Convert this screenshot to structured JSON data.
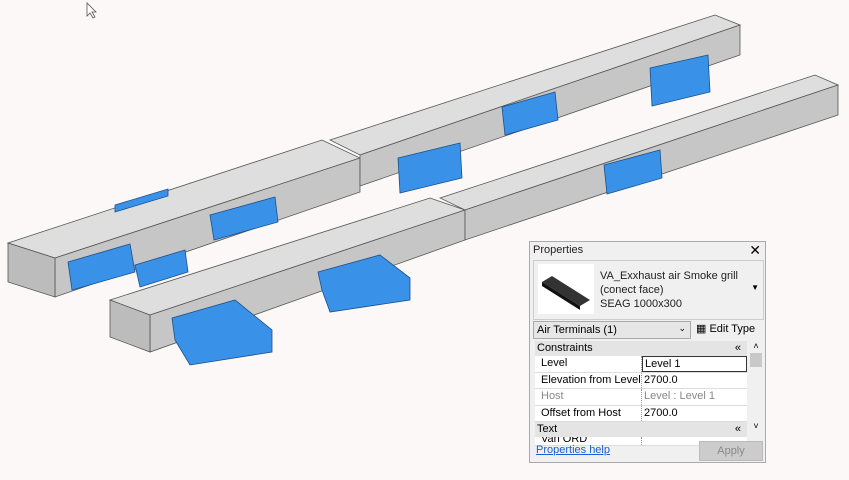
{
  "properties": {
    "title": "Properties",
    "type_name_line1": "VA_Exxhaust air Smoke grill",
    "type_name_line2": "(conect face)",
    "type_name_line3": "SEAG 1000x300",
    "selector": "Air Terminals (1)",
    "edit_type": "Edit Type",
    "categories": [
      {
        "name": "Constraints",
        "rows": [
          {
            "label": "Level",
            "value": "Level 1"
          },
          {
            "label": "Elevation from Level",
            "value": "2700.0"
          },
          {
            "label": "Host",
            "value": "Level : Level 1",
            "disabled": true
          },
          {
            "label": "Offset from Host",
            "value": "2700.0"
          }
        ]
      },
      {
        "name": "Text",
        "rows": [
          {
            "label": "Van ORD",
            "value": ""
          }
        ]
      }
    ],
    "help_link": "Properties help",
    "apply": "Apply"
  },
  "colors": {
    "duct": "#d4d4d4",
    "terminal": "#3a92e8",
    "background": "#fcf8f8"
  }
}
